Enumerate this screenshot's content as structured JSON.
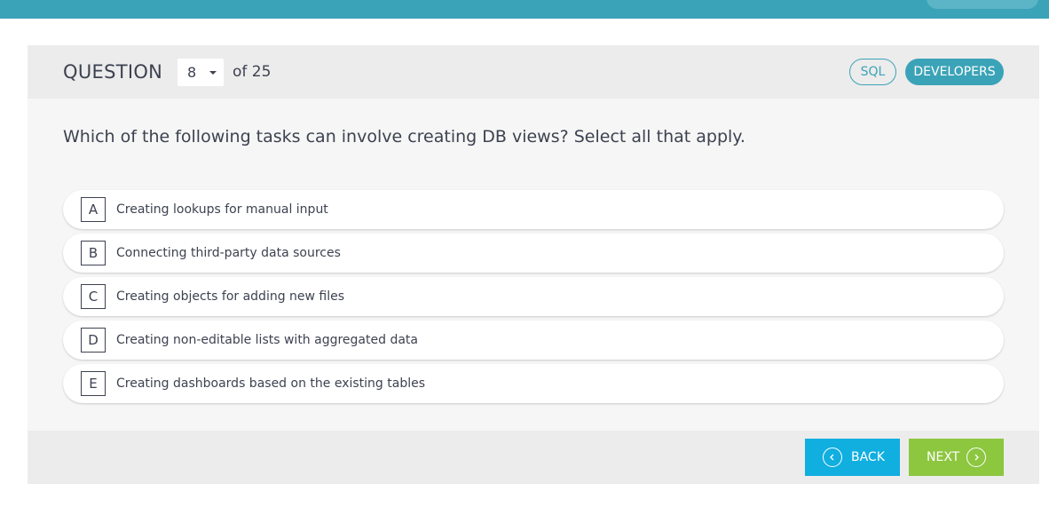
{
  "header": {
    "question_label": "QUESTION",
    "current_question": "8",
    "of_total": "of 25",
    "tags": [
      "SQL",
      "DEVELOPERS"
    ]
  },
  "question": {
    "text": "Which of the following tasks can involve creating DB views? Select all that apply."
  },
  "options": [
    {
      "letter": "A",
      "text": "Creating lookups for manual input"
    },
    {
      "letter": "B",
      "text": "Connecting third-party data sources"
    },
    {
      "letter": "C",
      "text": "Creating objects for adding new files"
    },
    {
      "letter": "D",
      "text": "Creating non-editable lists with aggregated data"
    },
    {
      "letter": "E",
      "text": "Creating dashboards based on the existing tables"
    }
  ],
  "footer": {
    "back_label": "BACK",
    "next_label": "NEXT"
  },
  "colors": {
    "accent": "#3ba3b7",
    "back_button": "#11aee0",
    "next_button": "#8dc63f"
  },
  "icons": {
    "back": "chevron-left-circle-icon",
    "next": "chevron-right-circle-icon",
    "select": "caret-down-icon"
  }
}
